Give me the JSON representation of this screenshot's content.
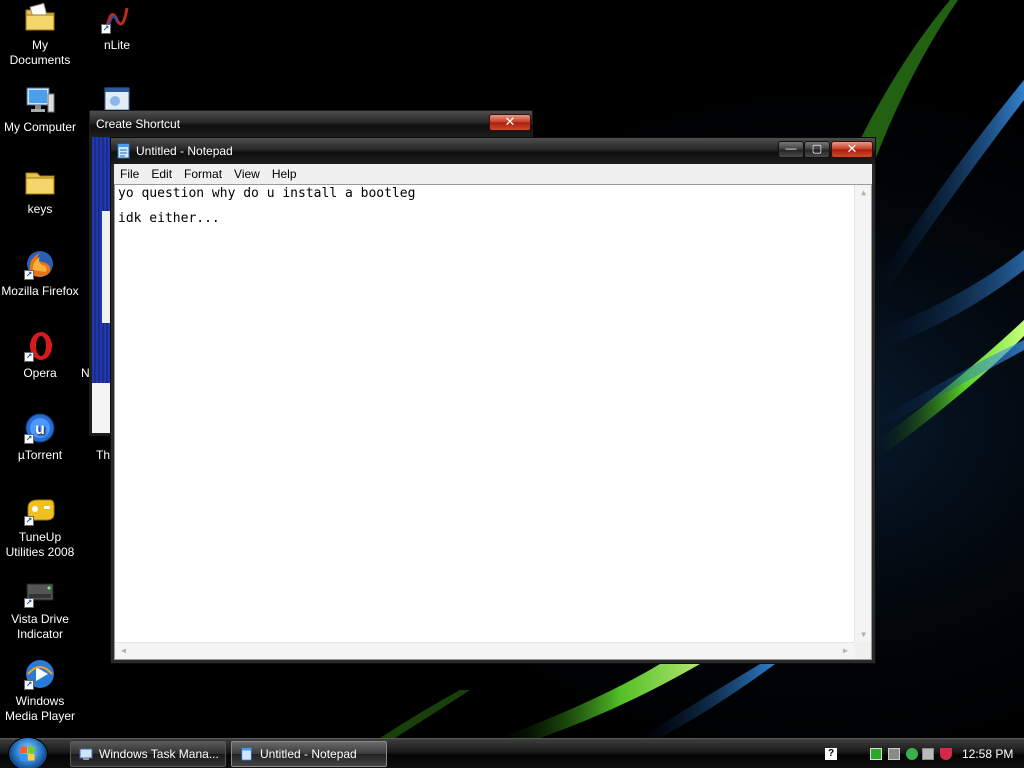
{
  "desktop": {
    "icons_left": [
      {
        "label": "My Documents",
        "icon": "folder-documents-icon"
      },
      {
        "label": "My Computer",
        "icon": "computer-icon"
      },
      {
        "label": "keys",
        "icon": "folder-icon"
      },
      {
        "label": "Mozilla Firefox",
        "icon": "firefox-icon"
      },
      {
        "label": "Opera",
        "icon": "opera-icon"
      },
      {
        "label": "µTorrent",
        "icon": "utorrent-icon"
      },
      {
        "label": "TuneUp Utilities 2008",
        "icon": "tuneup-icon"
      },
      {
        "label": "Vista Drive Indicator",
        "icon": "drive-icon"
      },
      {
        "label": "Windows Media Player",
        "icon": "media-player-icon"
      }
    ],
    "icons_col2": [
      {
        "label": "nLite",
        "icon": "nlite-icon"
      }
    ],
    "partial_labels": [
      "N",
      "Th"
    ]
  },
  "create_shortcut": {
    "title": "Create Shortcut",
    "close_label": "✕"
  },
  "notepad": {
    "title": "Untitled - Notepad",
    "minimize_label": "—",
    "maximize_label": "▢",
    "close_label": "✕",
    "menu": [
      "File",
      "Edit",
      "Format",
      "View",
      "Help"
    ],
    "lines": [
      "yo question why do u install a bootleg",
      "idk either..."
    ]
  },
  "taskbar": {
    "tasks": [
      {
        "label": "Windows Task Mana...",
        "icon": "task-manager-icon",
        "active": false
      },
      {
        "label": "Untitled - Notepad",
        "icon": "notepad-icon",
        "active": true
      }
    ],
    "help_label": "?",
    "clock": "12:58 PM"
  }
}
